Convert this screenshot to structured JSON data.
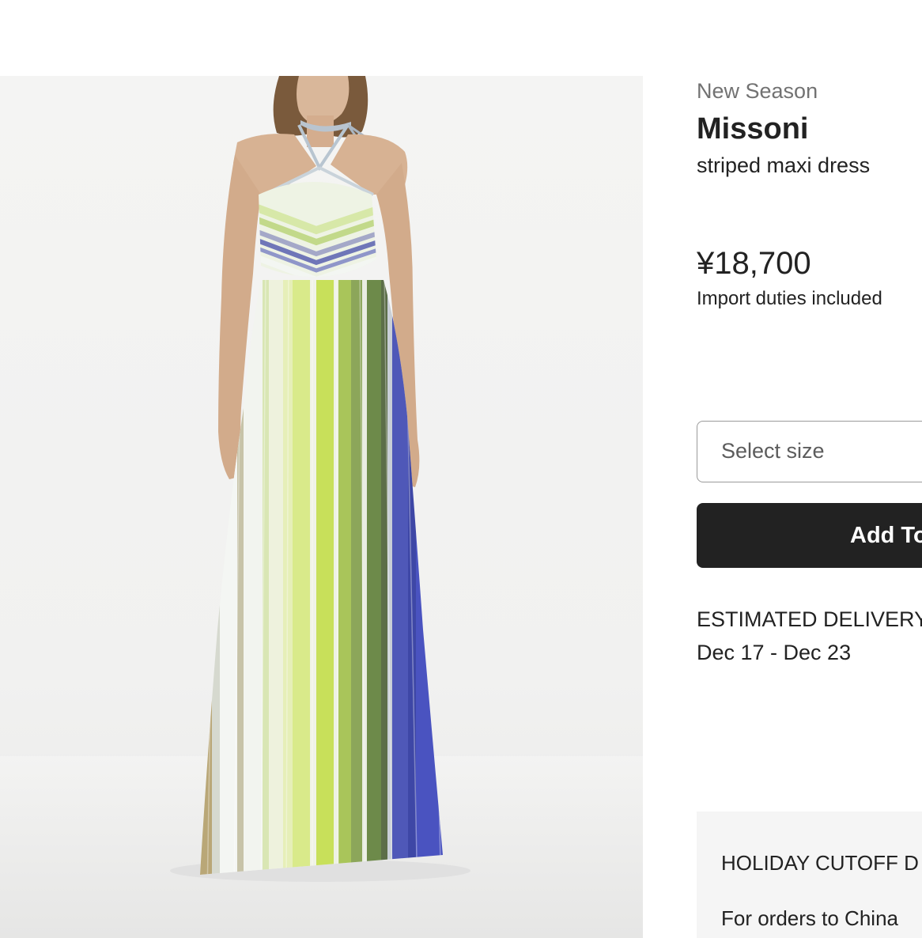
{
  "product": {
    "season_label": "New Season",
    "brand": "Missoni",
    "name": "striped maxi dress",
    "price": "¥18,700",
    "duties_note": "Import duties included",
    "image_alt": "Model wearing a striped pleated halter-neck maxi dress in white, lime green, olive and blue"
  },
  "purchase": {
    "size_placeholder": "Select size",
    "add_button_label": "Add To"
  },
  "delivery": {
    "label": "ESTIMATED DELIVERY",
    "dates": "Dec 17 - Dec 23"
  },
  "holiday": {
    "title": "HOLIDAY CUTOFF D",
    "text": "For orders to China"
  },
  "colors": {
    "button_background": "#222222",
    "muted_text": "#727272",
    "border": "#9a9a9a",
    "holiday_panel": "#f5f5f5",
    "dress_white": "#f2f4ef",
    "dress_lime": "#c8e05a",
    "dress_olive": "#6d8a4a",
    "dress_blue": "#4f58b8"
  }
}
